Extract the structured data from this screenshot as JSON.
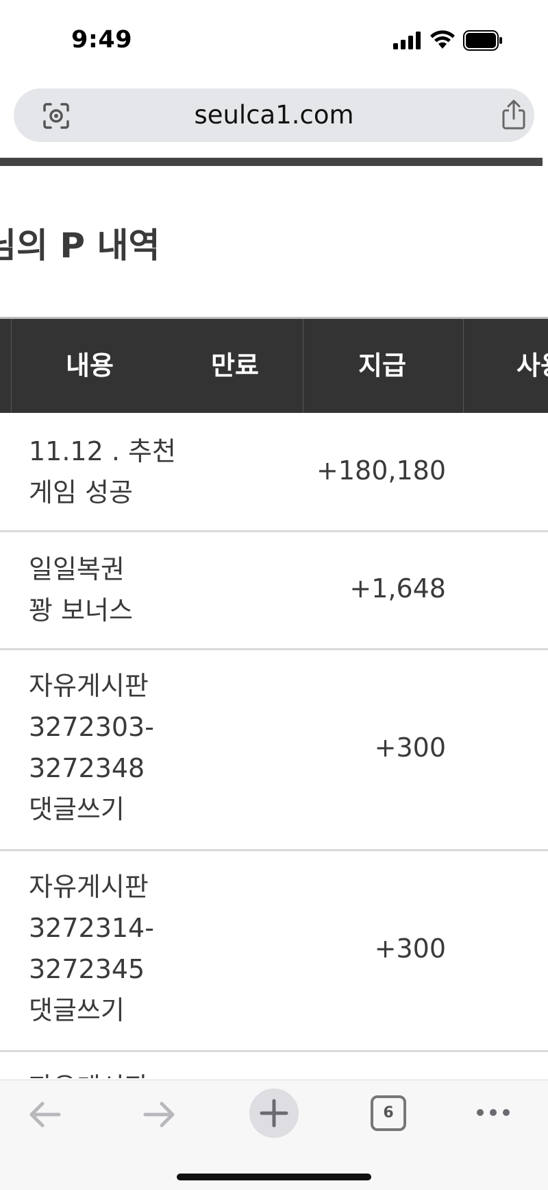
{
  "status_bar": {
    "time": "9:49"
  },
  "browser": {
    "url": "seulca1.com",
    "open_tabs_count": "6"
  },
  "page": {
    "title": "님의 P 내역",
    "table": {
      "headers": [
        "내용",
        "만료",
        "지급",
        "사용"
      ],
      "rows": [
        {
          "content_lines": [
            "11.12 . 추천",
            "게임 성공"
          ],
          "amount": "+180,180"
        },
        {
          "content_lines": [
            "일일복권",
            "꽝 보너스"
          ],
          "amount": "+1,648"
        },
        {
          "content_lines": [
            "자유게시판",
            "3272303-",
            "3272348",
            "댓글쓰기"
          ],
          "amount": "+300"
        },
        {
          "content_lines": [
            "자유게시판",
            "3272314-",
            "3272345",
            "댓글쓰기"
          ],
          "amount": "+300"
        }
      ],
      "partial_row_text": "자유게시판"
    }
  },
  "icons": {
    "status": [
      "signal-icon",
      "wifi-icon",
      "battery-icon"
    ],
    "url_bar": [
      "lens-icon",
      "share-icon"
    ],
    "toolbar": [
      "back-arrow-icon",
      "forward-arrow-icon",
      "plus-icon",
      "tabs-icon",
      "more-icon"
    ]
  },
  "colors": {
    "table_header_bg": "#333333",
    "url_bar_bg": "#e5e6e9",
    "text": "#3a3a3a"
  }
}
